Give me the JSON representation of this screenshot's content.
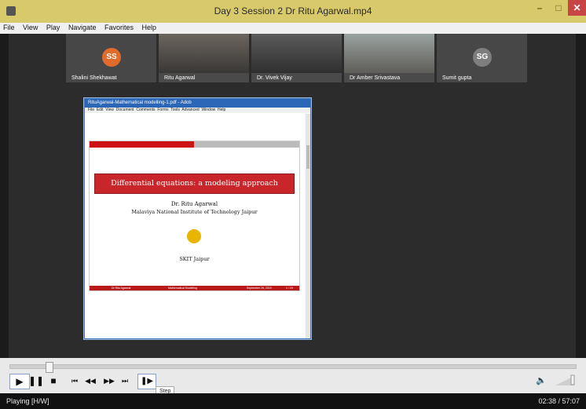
{
  "window": {
    "title": "Day 3 Session 2 Dr Ritu Agarwal.mp4",
    "minimize": "–",
    "maximize": "□",
    "close": "✕"
  },
  "menubar": {
    "items": [
      "File",
      "View",
      "Play",
      "Navigate",
      "Favorites",
      "Help"
    ]
  },
  "participants": [
    {
      "name": "Shalini Shekhawat",
      "initials": "SS",
      "color": "#e06b2d"
    },
    {
      "name": "Ritu Agarwal"
    },
    {
      "name": "Dr. Vivek Vijay"
    },
    {
      "name": "Dr Amber Srivastava"
    },
    {
      "name": "Sumit gupta",
      "initials": "SG",
      "color": "#7e7e7e"
    }
  ],
  "pdf": {
    "title": "RituAgarwal-Mathematical modelling-1.pdf - Adob",
    "menu": [
      "File",
      "Edit",
      "View",
      "Document",
      "Comments",
      "Forms",
      "Tools",
      "Advanced",
      "Window",
      "Help"
    ],
    "slide_title": "Differential equations: a modeling approach",
    "author": "Dr. Ritu Agarwal",
    "institute": "Malaviya National Institute of Technology Jaipur",
    "venue": "SKIT Jaipur",
    "footer": {
      "left": "Dr Ritu Agarwal",
      "center": "Mathematical Modelling",
      "right": "September 25, 2019",
      "page": "1 / 19"
    }
  },
  "player": {
    "progress": 0.04,
    "step_tooltip": "Step",
    "status": "Playing [H/W]",
    "time": "02:38 / 57:07",
    "icons": {
      "play": "▶",
      "pause": "❚❚",
      "stop": "■",
      "prev": "⏮",
      "rew": "◀◀",
      "fwd": "▶▶",
      "next": "⏭",
      "step": "❚▶",
      "volume": "🔈"
    }
  }
}
